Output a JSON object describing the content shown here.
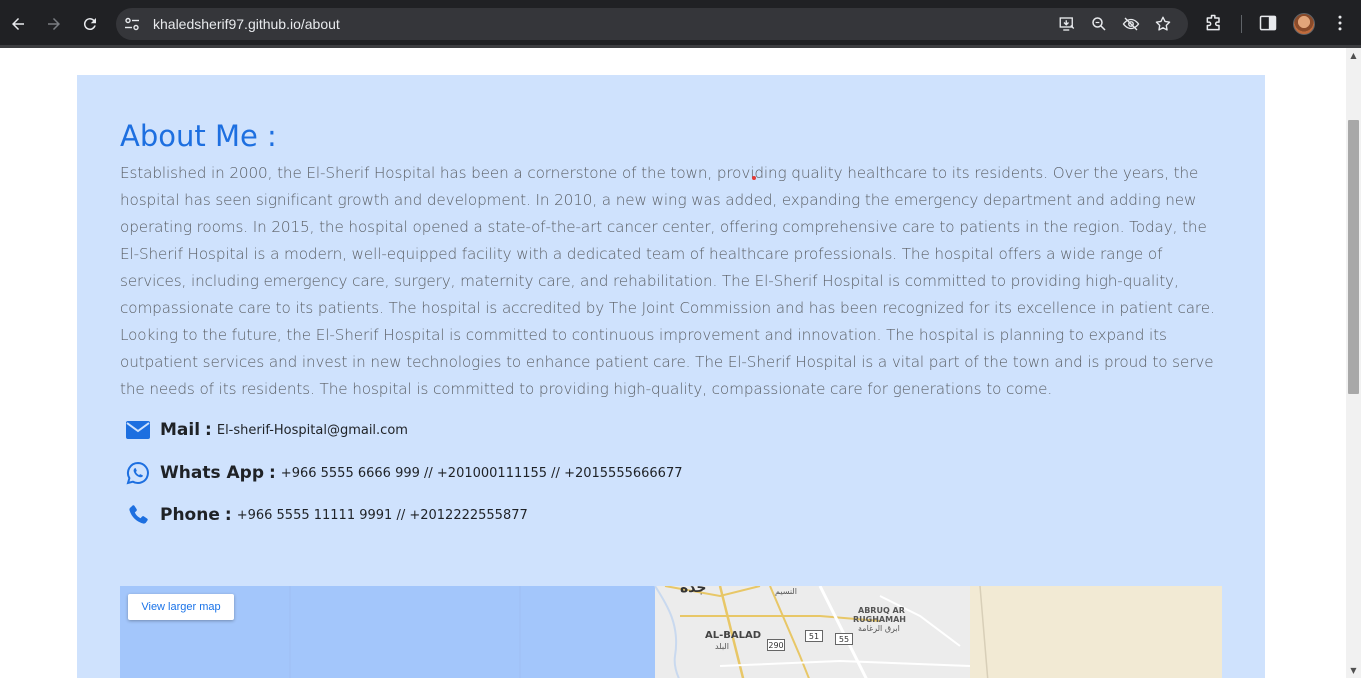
{
  "browser": {
    "url": "khaledsherif97.github.io/about"
  },
  "page": {
    "title": "About Me :",
    "paragraph": "Established in 2000, the El-Sherif Hospital has been a cornerstone of the town, providing quality healthcare to its residents. Over the years, the hospital has seen significant growth and development. In 2010, a new wing was added, expanding the emergency department and adding new operating rooms. In 2015, the hospital opened a state-of-the-art cancer center, offering comprehensive care to patients in the region. Today, the El-Sherif Hospital is a modern, well-equipped facility with a dedicated team of healthcare professionals. The hospital offers a wide range of services, including emergency care, surgery, maternity care, and rehabilitation. The El-Sherif Hospital is committed to providing high-quality, compassionate care to its patients. The hospital is accredited by The Joint Commission and has been recognized for its excellence in patient care. Looking to the future, the El-Sherif Hospital is committed to continuous improvement and innovation. The hospital is planning to expand its outpatient services and invest in new technologies to enhance patient care. The El-Sherif Hospital is a vital part of the town and is proud to serve the needs of its residents. The hospital is committed to providing high-quality, compassionate care for generations to come.",
    "contacts": {
      "mail": {
        "label": "Mail",
        "value": "El-sherif-Hospital@gmail.com"
      },
      "whatsapp": {
        "label": "Whats App",
        "value": "+966 5555 6666 999 // +201000111155 // +2015555666677"
      },
      "phone": {
        "label": "Phone",
        "value": "+966 5555 11111 9991 // +2012222555877"
      }
    },
    "colon": ":"
  },
  "map": {
    "button": "View larger map",
    "labels": {
      "jeddah_ar": "جدة",
      "al_balad": "AL-BALAD",
      "al_balad_ar": "البلد",
      "abruq": "ABRUQ AR",
      "rughamah": "RUGHAMAH",
      "rughamah_ar": "ابرق الرغامة",
      "alnaseem_ar": "النسيم",
      "road_290": "290",
      "road_51": "51",
      "road_55": "55"
    }
  },
  "colors": {
    "card_bg": "#cfe2fd",
    "accent": "#1d6fe0",
    "chrome_bg": "#202124"
  }
}
